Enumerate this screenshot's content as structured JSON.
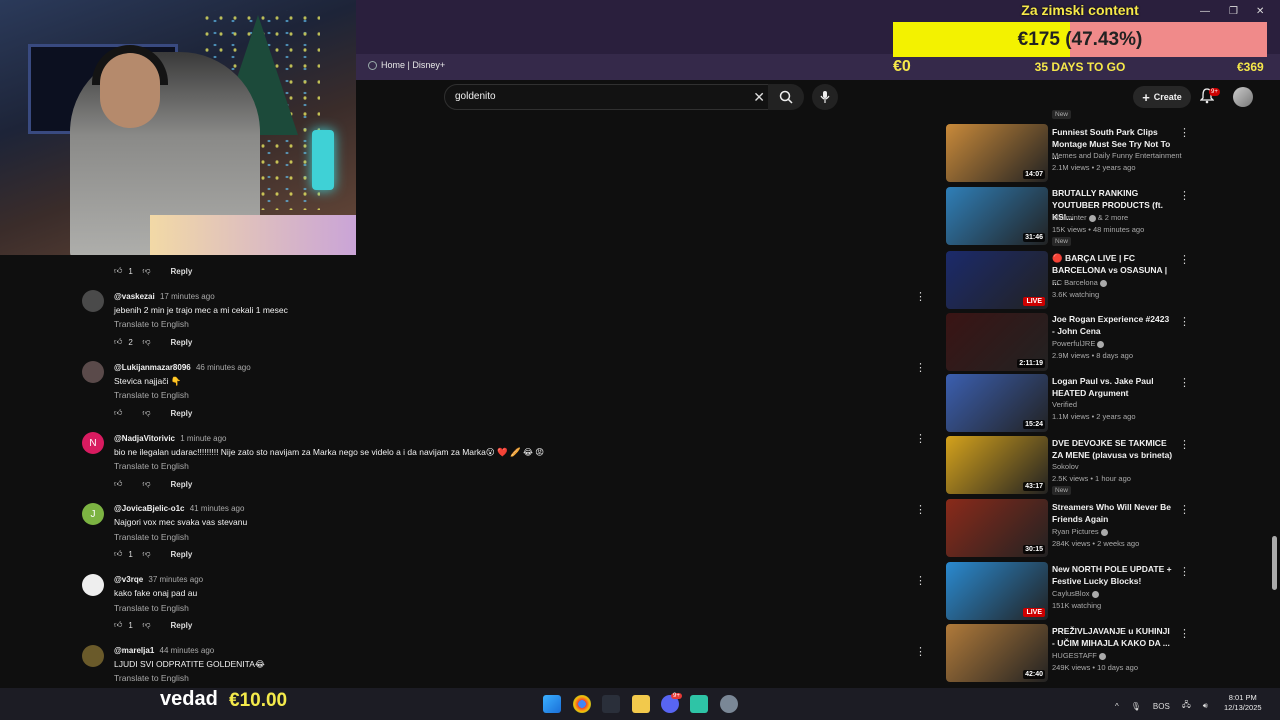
{
  "browser": {
    "bookmark_label": "Home | Disney+"
  },
  "search": {
    "query": "goldenito"
  },
  "header": {
    "create_label": "Create",
    "notifications_badge": "9+"
  },
  "goal_widget": {
    "title": "Za zimski content",
    "amount_label": "€175 (47.43%)",
    "progress_percent": 47.43,
    "min_label": "€0",
    "days_label": "35 DAYS TO GO",
    "max_label": "€369",
    "colors": {
      "fill": "#f3f200",
      "remaining": "#f08a8a",
      "text": "#f6e84a"
    }
  },
  "comments": [
    {
      "handle": "",
      "time": "",
      "text": "",
      "translate": "",
      "likes": "1",
      "reply": "Reply",
      "avatar_letter": "",
      "avatar_color": "#555"
    },
    {
      "handle": "@vaskezai",
      "time": "17 minutes ago",
      "text": "jebenih 2 min je trajo mec a mi cekali 1 mesec",
      "translate": "Translate to English",
      "likes": "2",
      "reply": "Reply",
      "avatar_letter": "",
      "avatar_color": "#4a4a4a"
    },
    {
      "handle": "@Lukijanmazar8096",
      "time": "46 minutes ago",
      "text": "Stevica najjači 👇",
      "translate": "Translate to English",
      "likes": "",
      "reply": "Reply",
      "avatar_letter": "",
      "avatar_color": "#5a4a4a"
    },
    {
      "handle": "@NadjaVitorivic",
      "time": "1 minute ago",
      "text": "bio ne ilegalan udarac!!!!!!!!! Nije zato sto navijam za Marka nego se videlo a i da navijam za Marka😮 ❤️ 🥖 😂 😡",
      "translate": "Translate to English",
      "likes": "",
      "reply": "Reply",
      "avatar_letter": "N",
      "avatar_color": "#d81b60"
    },
    {
      "handle": "@JovicaBjelic-o1c",
      "time": "41 minutes ago",
      "text": "Najgori vox mec svaka vas stevanu",
      "translate": "Translate to English",
      "likes": "1",
      "reply": "Reply",
      "avatar_letter": "J",
      "avatar_color": "#7cb342"
    },
    {
      "handle": "@v3rqe",
      "time": "37 minutes ago",
      "text": "kako fake onaj pad au",
      "translate": "Translate to English",
      "likes": "1",
      "reply": "Reply",
      "avatar_letter": "",
      "avatar_color": "#eeeeee"
    },
    {
      "handle": "@marelja1",
      "time": "44 minutes ago",
      "text": "LJUDI SVI ODPRATITE GOLDENITA😂",
      "translate": "Translate to English",
      "likes": "",
      "reply": "",
      "avatar_letter": "",
      "avatar_color": "#6a5a2a"
    }
  ],
  "videos": [
    {
      "title": "Funniest South Park Clips Montage Must See Try Not To ...",
      "channel": "Memes and Daily Funny Entertainment",
      "meta": "2.1M views • 2 years ago",
      "duration": "14:07",
      "badge": "",
      "verified": false,
      "live": false,
      "thumb": "#c98a3a"
    },
    {
      "title": "BRUTALLY RANKING YOUTUBER PRODUCTS (ft. KSI...",
      "channel": "Miniminter",
      "channel_suffix": "& 2 more",
      "meta": "15K views • 48 minutes ago",
      "duration": "31:46",
      "badge": "New",
      "verified": true,
      "live": false,
      "thumb": "#2f7fb8"
    },
    {
      "title": "🔴 BARÇA LIVE | FC BARCELONA vs OSASUNA | ...",
      "channel": "FC Barcelona",
      "meta": "3.6K watching",
      "duration": "LIVE",
      "badge": "",
      "verified": true,
      "live": true,
      "thumb": "#1b2a6b"
    },
    {
      "title": "Joe Rogan Experience #2423 - John Cena",
      "channel": "PowerfulJRE",
      "meta": "2.9M views • 8 days ago",
      "duration": "2:11:19",
      "badge": "",
      "verified": true,
      "live": false,
      "thumb": "#3a1414"
    },
    {
      "title": "Logan Paul vs. Jake Paul HEATED Argument",
      "channel": "Verified",
      "meta": "1.1M views • 2 years ago",
      "duration": "15:24",
      "badge": "",
      "verified": false,
      "live": false,
      "thumb": "#3b5fb0"
    },
    {
      "title": "DVE DEVOJKE SE TAKMICE ZA MENE (plavusa vs brineta)",
      "channel": "Sokolov",
      "meta": "2.5K views • 1 hour ago",
      "duration": "43:17",
      "badge": "New",
      "verified": false,
      "live": false,
      "thumb": "#d4a21c"
    },
    {
      "title": "Streamers Who Will Never Be Friends Again",
      "channel": "Ryan Pictures",
      "meta": "284K views • 2 weeks ago",
      "duration": "30:15",
      "badge": "",
      "verified": true,
      "live": false,
      "thumb": "#8a2a1a"
    },
    {
      "title": "New NORTH POLE UPDATE + Festive Lucky Blocks!",
      "channel": "CaylusBlox",
      "meta": "151K watching",
      "duration": "LIVE",
      "badge": "",
      "verified": true,
      "live": true,
      "thumb": "#2a8ad0"
    },
    {
      "title": "PREŽIVLJAVANJE u KUHINJI - UČIM MIHAJLA KAKO DA ...",
      "channel": "HUGESTAFF",
      "meta": "249K views • 10 days ago",
      "duration": "42:40",
      "badge": "",
      "verified": true,
      "live": false,
      "thumb": "#b07a3a"
    }
  ],
  "top_partial_badge": "New",
  "stream_overlay": {
    "tipper_name": "vedad",
    "tip_amount": "€10.00"
  },
  "taskbar": {
    "language": "BOS",
    "time": "8:01 PM",
    "date": "12/13/2025",
    "discord_badge": "9+"
  }
}
